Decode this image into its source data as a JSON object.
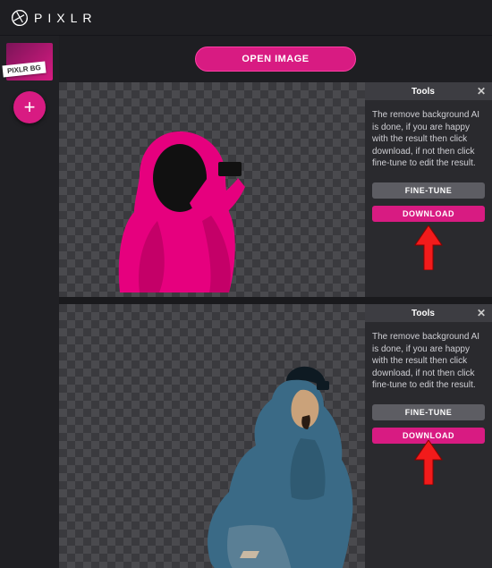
{
  "brand": "PIXLR",
  "sidebar": {
    "bg_label": "PIXLR BG",
    "add_glyph": "+"
  },
  "open_image_label": "OPEN IMAGE",
  "panels": [
    {
      "tools_title": "Tools",
      "description": "The remove background AI is done, if you are happy with the result then click download, if not then click fine-tune to edit the result.",
      "finetune_label": "FINE-TUNE",
      "download_label": "DOWNLOAD"
    },
    {
      "tools_title": "Tools",
      "description": "The remove background AI is done, if you are happy with the result then click download, if not then click fine-tune to edit the result.",
      "finetune_label": "FINE-TUNE",
      "download_label": "DOWNLOAD"
    }
  ],
  "colors": {
    "accent": "#d81b82",
    "arrow": "#F21B1B"
  }
}
